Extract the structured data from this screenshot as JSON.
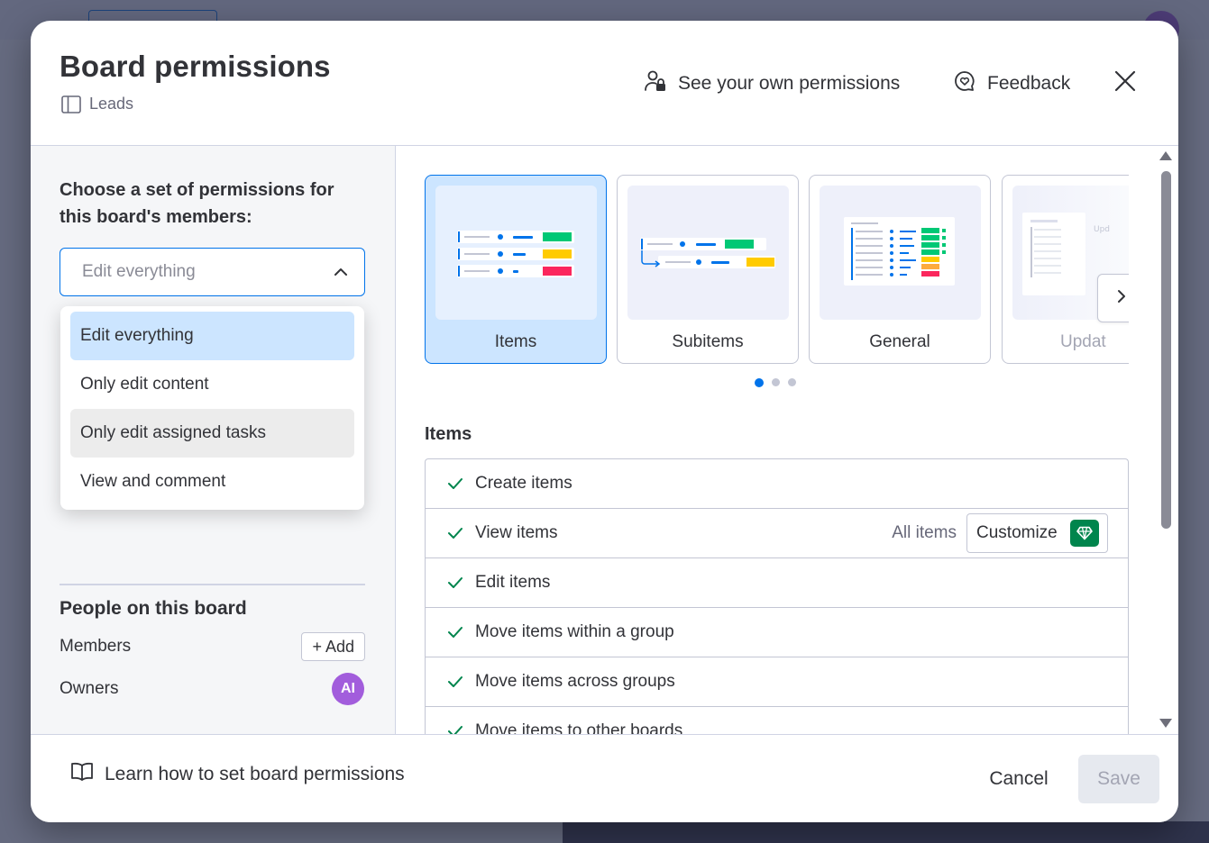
{
  "modal": {
    "title": "Board permissions",
    "board_name": "Leads",
    "see_permissions_label": "See your own permissions",
    "feedback_label": "Feedback"
  },
  "left_panel": {
    "heading": "Choose a set of permissions for this board's members:",
    "select_value": "Edit everything",
    "options": [
      {
        "label": "Edit everything",
        "state": "selected"
      },
      {
        "label": "Only edit content",
        "state": "normal"
      },
      {
        "label": "Only edit assigned tasks",
        "state": "hovered"
      },
      {
        "label": "View and comment",
        "state": "normal"
      }
    ],
    "people": {
      "title": "People on this board",
      "members_label": "Members",
      "add_label": "+ Add",
      "owners_label": "Owners",
      "owner_avatar_initials": "AI"
    }
  },
  "right_panel": {
    "cards": [
      {
        "label": "Items",
        "active": true
      },
      {
        "label": "Subitems",
        "active": false
      },
      {
        "label": "General",
        "active": false
      },
      {
        "label": "Updat",
        "active": false
      }
    ],
    "carousel": {
      "pages": 3,
      "current_page": 1
    },
    "section_title": "Items",
    "permissions": [
      {
        "label": "Create items"
      },
      {
        "label": "View items",
        "scope": "All items",
        "action": "Customize"
      },
      {
        "label": "Edit items"
      },
      {
        "label": "Move items within a group"
      },
      {
        "label": "Move items across groups"
      },
      {
        "label": "Move items to other boards"
      }
    ]
  },
  "footer": {
    "learn_label": "Learn how to set board permissions",
    "cancel_label": "Cancel",
    "save_label": "Save"
  },
  "colors": {
    "accent": "#0073ea",
    "selected_bg": "#cce5ff",
    "check": "#00854d",
    "avatar": "#a25ddc"
  }
}
